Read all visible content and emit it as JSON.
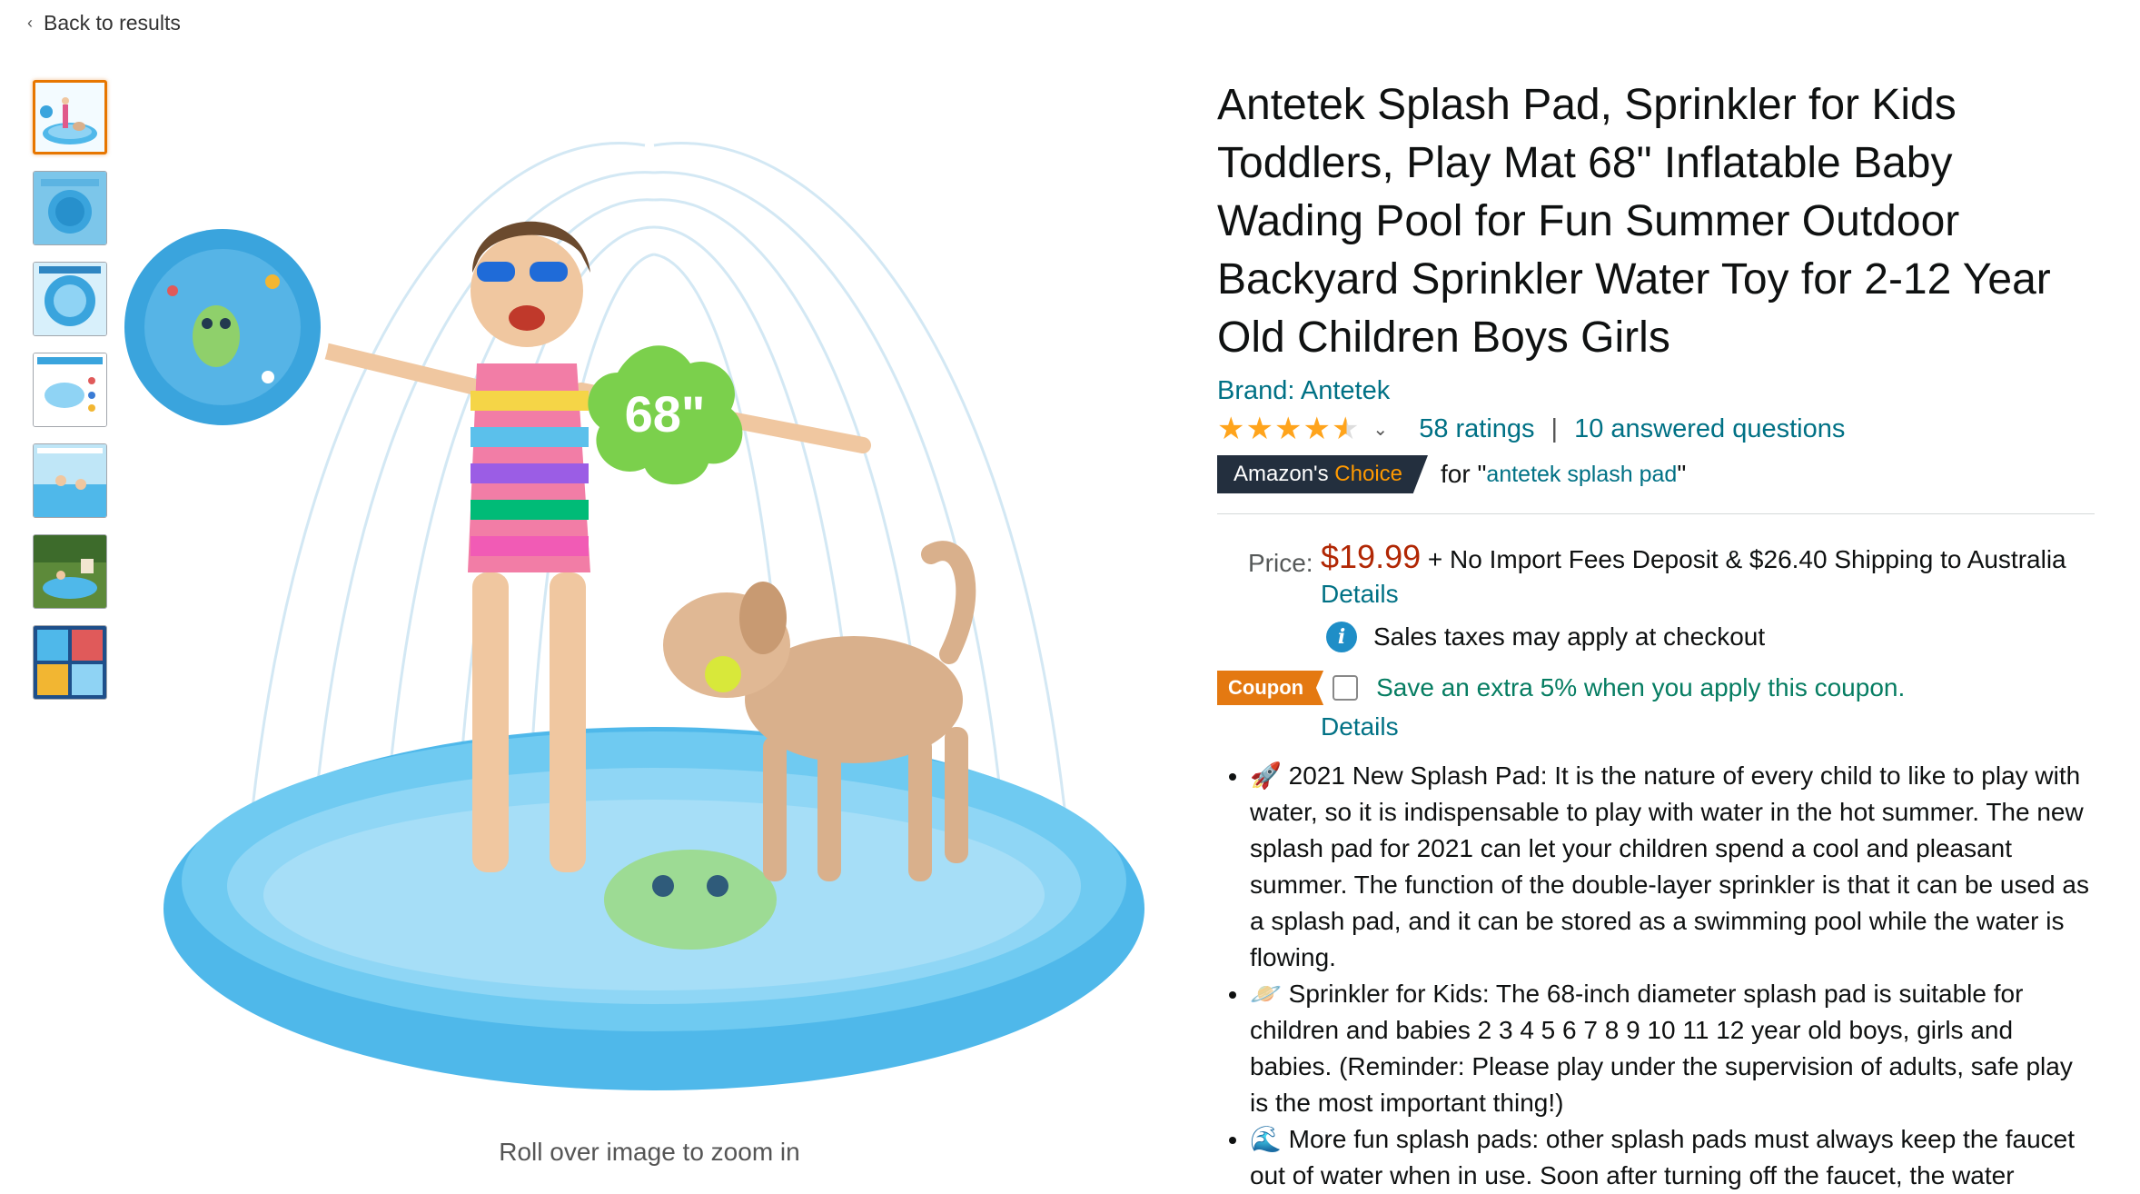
{
  "nav": {
    "back_label": "Back to results"
  },
  "product": {
    "title": "Antetek Splash Pad, Sprinkler for Kids Toddlers, Play Mat 68\" Inflatable Baby Wading Pool for Fun Summer Outdoor Backyard Sprinkler Water Toy for 2-12 Year Old Children Boys Girls",
    "brand": "Brand: Antetek",
    "rating_value": 4.5,
    "ratings_count": "58 ratings",
    "separator": "|",
    "answered_questions": "10 answered questions",
    "choice_badge_prefix": "Amazon's",
    "choice_badge_word": "Choice",
    "choice_for": "for \"",
    "choice_keyword": "antetek splash pad",
    "choice_close": "\""
  },
  "price": {
    "label": "Price:",
    "amount": "$19.99",
    "shipping": "+ No Import Fees Deposit & $26.40 Shipping to Australia",
    "details_link": "Details",
    "tax_note": "Sales taxes may apply at checkout"
  },
  "coupon": {
    "tag": "Coupon",
    "text": "Save an extra 5% when you apply this coupon.",
    "details_link": "Details"
  },
  "bullets": [
    "🚀 2021 New Splash Pad: It is the nature of every child to like to play with water, so it is indispensable to play with water in the hot summer. The new splash pad for 2021 can let your children spend a cool and pleasant summer. The function of the double-layer sprinkler is that it can be used as a splash pad, and it can be stored as a swimming pool while the water is flowing.",
    "🪐 Sprinkler for Kids: The 68-inch diameter splash pad is suitable for children and babies 2 3 4 5 6 7 8 9 10 11 12 year old boys, girls and babies. (Reminder: Please play under the supervision of adults, safe play is the most important thing!)",
    "🌊 More fun splash pads: other splash pads must always keep the faucet out of water when in use. Soon after turning off the faucet, the water"
  ],
  "gallery": {
    "zoom_hint": "Roll over image to zoom in",
    "badge_text": "68\"",
    "thumbnail_count": 7
  },
  "colors": {
    "link": "#007185",
    "price": "#B12704",
    "star": "#FFA41C",
    "badge_bg": "#232F3E",
    "badge_accent": "#FF9900",
    "coupon_tag": "#E47911",
    "coupon_text": "#067D62",
    "pool": "#4FB8EA"
  }
}
